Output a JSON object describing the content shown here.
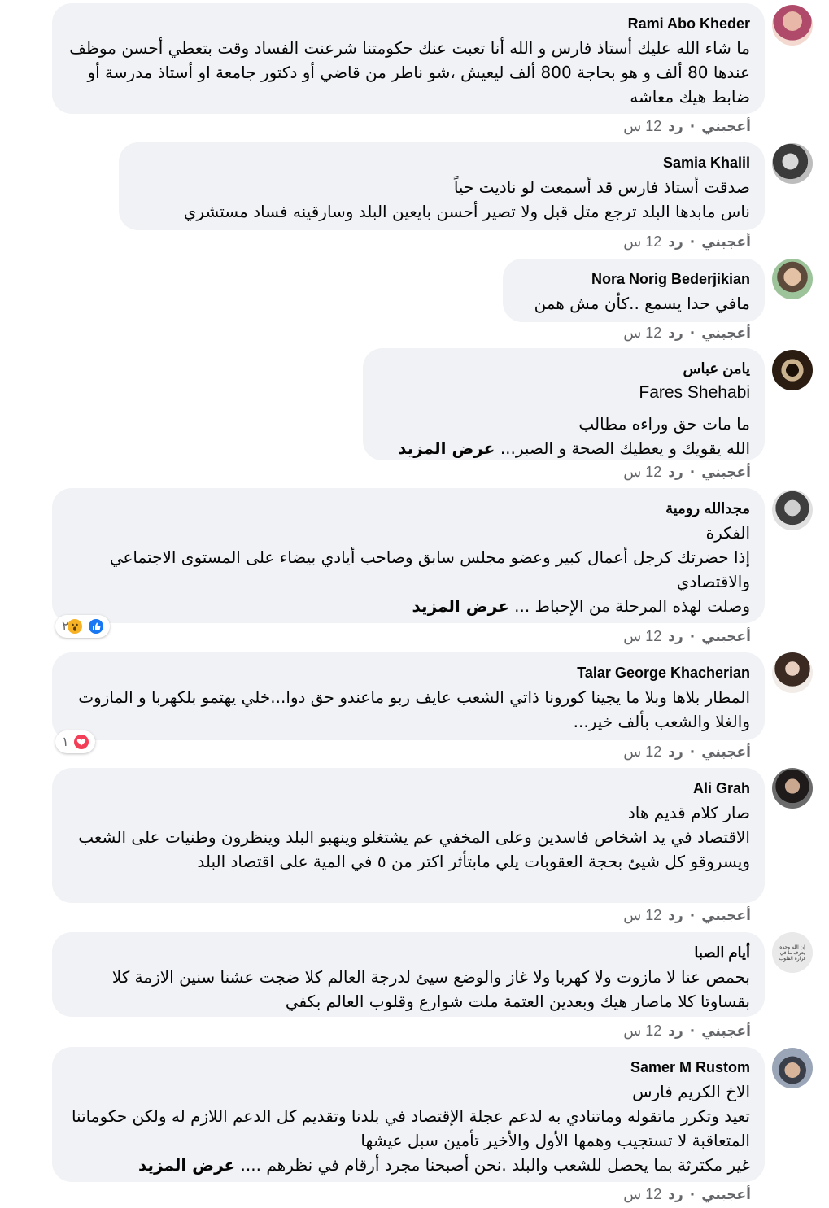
{
  "actions": {
    "like": "أعجبني",
    "reply": "رد",
    "dot": "·",
    "time": "12 س"
  },
  "see_more": "عرض المزيد",
  "comments": [
    {
      "author": "Rami Abo Kheder",
      "text": "ما شاء الله عليك أستاذ فارس و الله أنا تعبت عنك حكومتنا شرعنت الفساد وقت بتعطي أحسن موظف عندها 80 ألف و هو بحاجة 800 ألف ليعيش ،شو ناطر من قاضي أو دكتور جامعة او أستاذ مدرسة أو ضابط هيك معاشه"
    },
    {
      "author": "Samia Khalil",
      "text": "صدقت أستاذ فارس قد أسمعت لو ناديت حياً\nناس مابدها البلد ترجع متل قبل ولا تصير أحسن بايعين البلد وسارقينه فساد مستشري"
    },
    {
      "author": "Nora Norig Bederjikian",
      "text": "مافي حدا يسمع ..كأن مش همن"
    },
    {
      "author": "يامن عباس",
      "tag": "Fares Shehabi",
      "text": "ما مات حق وراءه مطالب\nالله يقويك و يعطيك الصحة و الصبر... "
    },
    {
      "author": "مجدالله رومية",
      "text": "الفكرة\nإذا حضرتك كرجل أعمال كبير وعضو مجلس سابق وصاحب أيادي بيضاء على المستوى الاجتماعي والاقتصادي\nوصلت لهذه المرحلة من الإحباط ... ",
      "reactions_count": "٢"
    },
    {
      "author": "Talar George Khacherian",
      "text": "المطار بلاها وبلا ما يجينا كورونا ذاتي الشعب عايف ربو ماعندو حق دوا...خلي يهتمو بلكهربا و المازوت والغلا والشعب بألف خير...",
      "reactions_count": "١"
    },
    {
      "author": "Ali Grah",
      "text": "صار كلام قديم هاد\nالاقتصاد في يد اشخاص فاسدين وعلى المخفي عم يشتغلو وينهبو البلد وينظرون وطنيات على الشعب ويسروقو كل شيئ بحجة العقوبات يلي مابتأثر اكتر من ٥ في المية على اقتصاد البلد"
    },
    {
      "author": "أيام الصبا",
      "avatar_text": "إن الله وحده يعرف ما في قرارة القلوب",
      "text": "بحمص عنا لا مازوت ولا كهربا ولا غاز والوضع سيئ لدرجة العالم كلا ضجت عشنا سنين الازمة كلا بقساوتا كلا ماصار هيك وبعدين العتمة ملت شوارع وقلوب العالم بكفي"
    },
    {
      "author": "Samer M Rustom",
      "text": "الاخ الكريم فارس\nتعيد وتكرر ماتقوله وماتنادي به لدعم عجلة الإقتصاد في بلدنا وتقديم كل الدعم اللازم له ولكن حكوماتنا المتعاقبة لا تستجيب وهمها الأول والأخير تأمين سبل عيشها\nغير مكترثة بما يحصل للشعب والبلد .نحن أصبحنا مجرد أرقام في نظرهم .... "
    }
  ]
}
